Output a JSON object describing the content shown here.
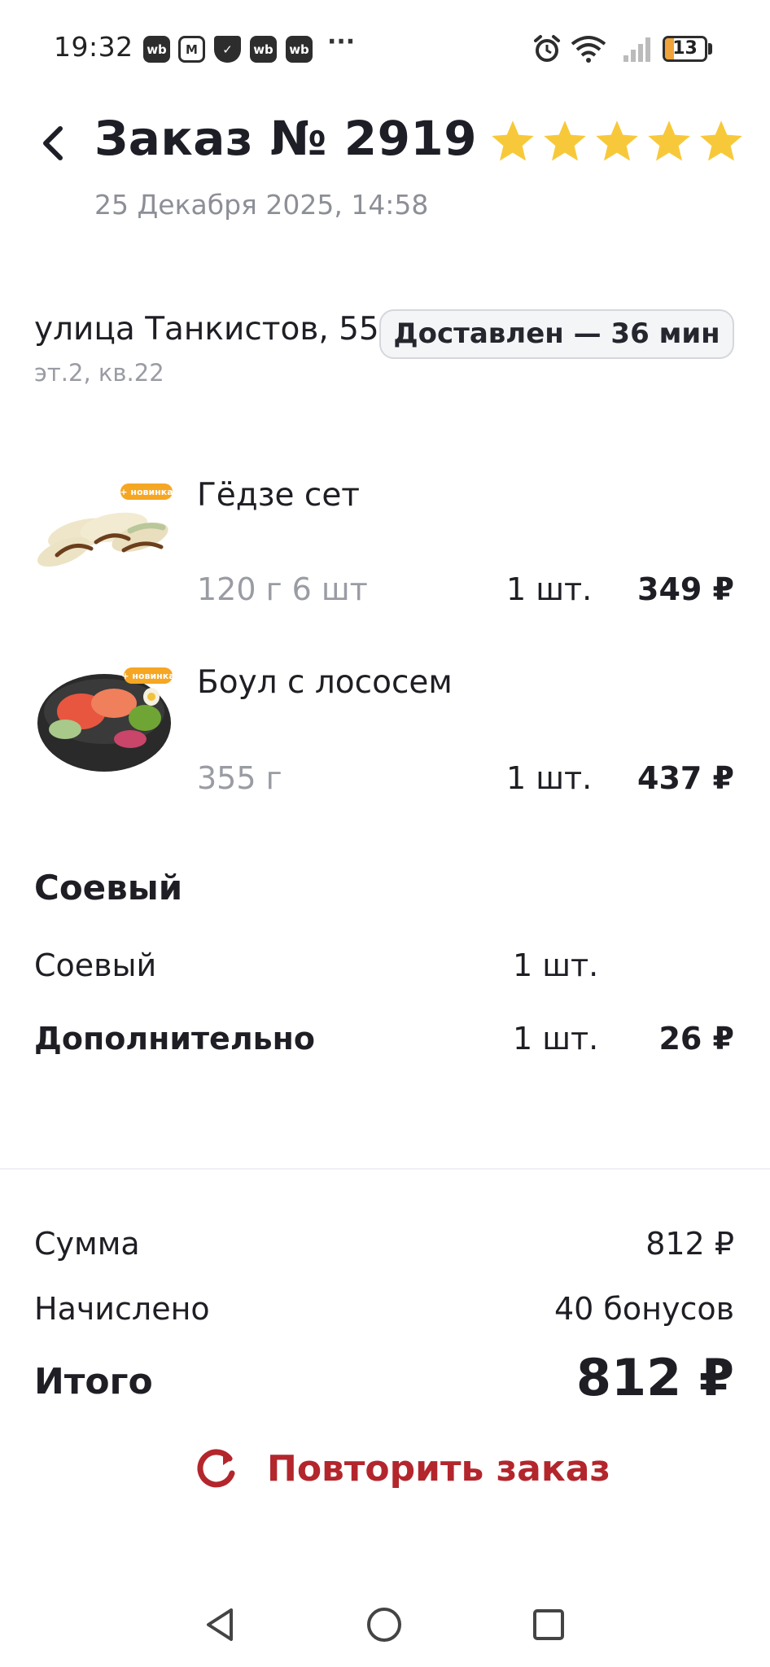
{
  "status_bar": {
    "time": "19:32",
    "app_icons": [
      "wb",
      "М",
      "✓",
      "wb",
      "wb"
    ],
    "more": "···",
    "battery": "13"
  },
  "header": {
    "title": "Заказ № 2919",
    "date": "25 Декабря 2025, 14:58",
    "rating": 5
  },
  "delivery": {
    "address": "улица Танкистов, 55",
    "address_details": "эт.2, кв.22",
    "status": "Доставлен — 36 мин"
  },
  "items": [
    {
      "name": "Гёдзе сет",
      "weight": "120 г 6 шт",
      "qty": "1 шт.",
      "price": "349 ₽",
      "badge": "+ новинка"
    },
    {
      "name": "Боул с лососем",
      "weight": "355 г",
      "qty": "1 шт.",
      "price": "437 ₽",
      "badge": "+ новинка"
    }
  ],
  "modifiers": {
    "title": "Соевый",
    "rows": [
      {
        "name": "Соевый",
        "qty": "1 шт.",
        "price": ""
      },
      {
        "name": "Дополнительно",
        "qty": "1 шт.",
        "price": "26 ₽"
      }
    ]
  },
  "summary": {
    "sum_label": "Сумма",
    "sum_value": "812 ₽",
    "bonus_label": "Начислено",
    "bonus_value": "40 бонусов",
    "total_label": "Итого",
    "total_value": "812 ₽"
  },
  "actions": {
    "repeat_label": "Повторить заказ"
  },
  "colors": {
    "accent": "#b3262c",
    "star": "#f7c93a",
    "muted": "#9a9ca4"
  }
}
